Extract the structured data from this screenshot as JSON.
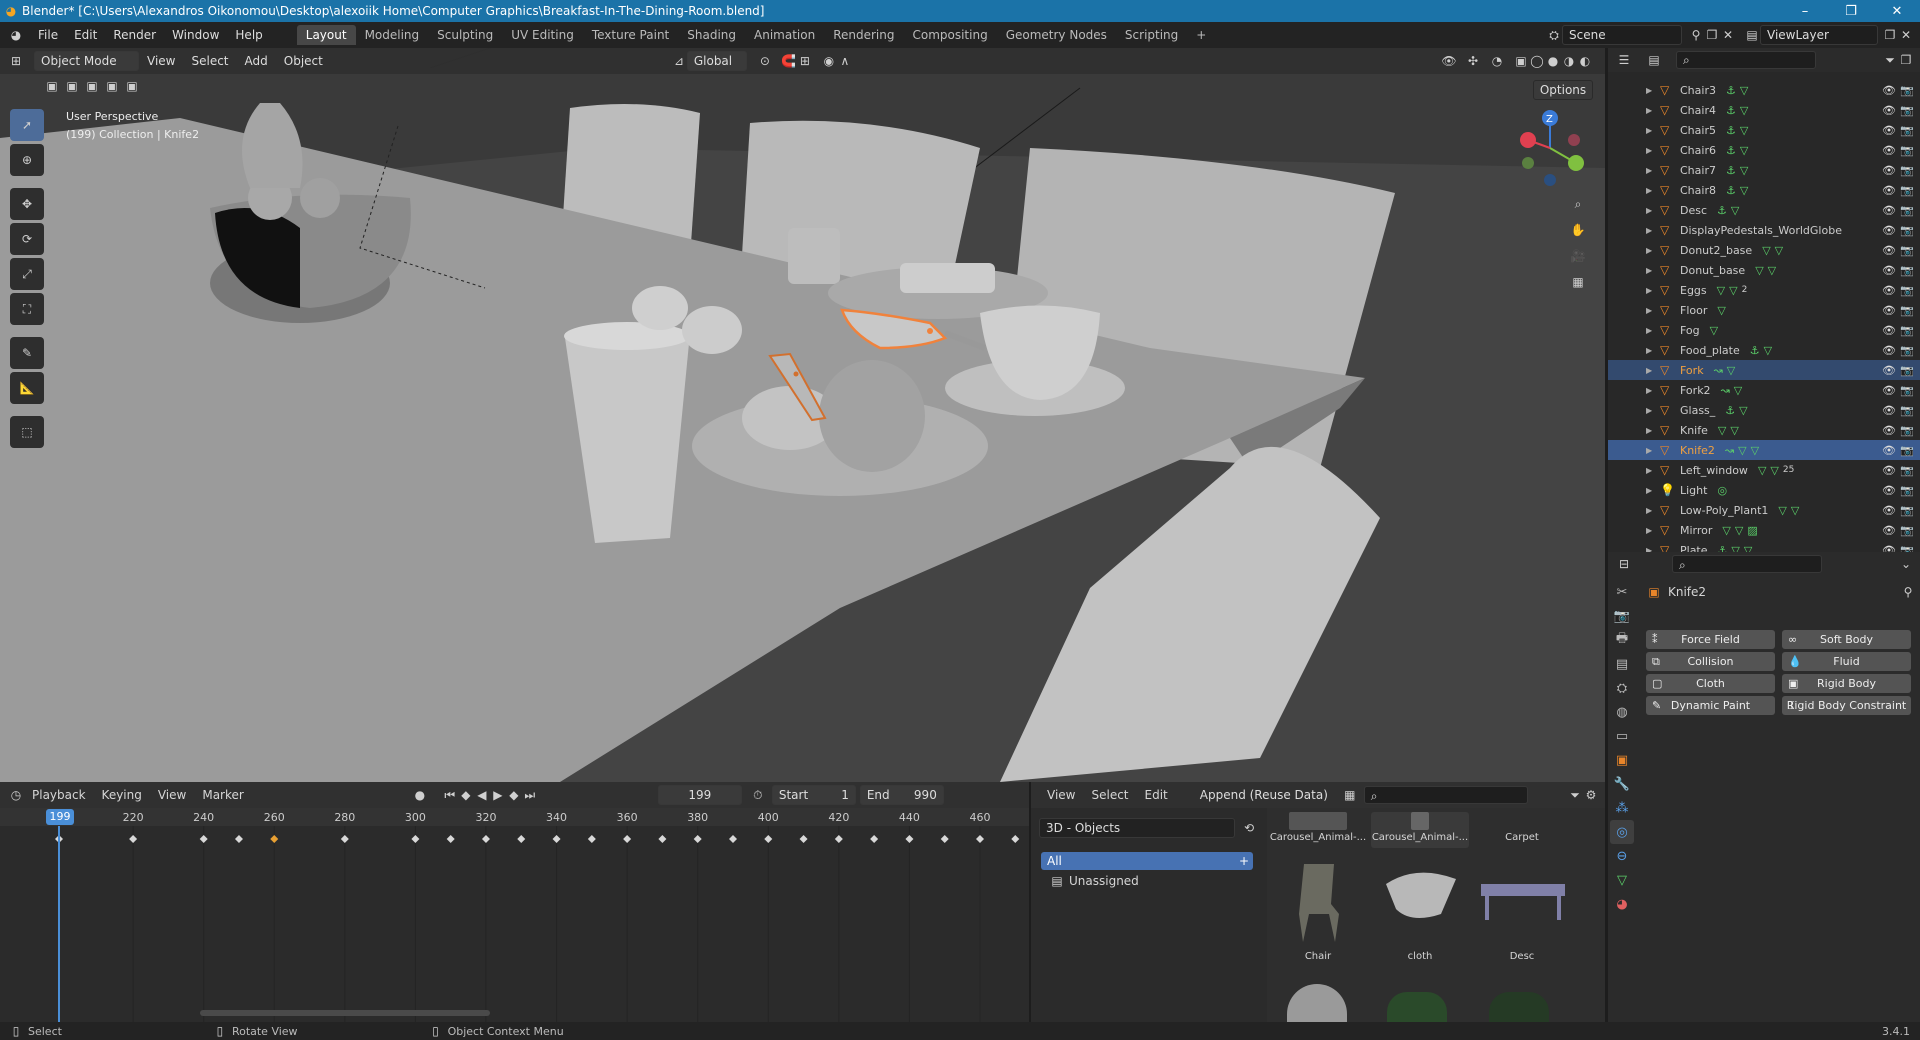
{
  "title_bar": {
    "text": "Blender* [C:\\Users\\Alexandros Oikonomou\\Desktop\\alexoiik Home\\Computer Graphics\\Breakfast-In-The-Dining-Room.blend]",
    "minimize": "–",
    "maximize": "❐",
    "close": "✕"
  },
  "menus": [
    "File",
    "Edit",
    "Render",
    "Window",
    "Help"
  ],
  "workspaces": [
    {
      "label": "Layout",
      "active": true
    },
    {
      "label": "Modeling"
    },
    {
      "label": "Sculpting"
    },
    {
      "label": "UV Editing"
    },
    {
      "label": "Texture Paint"
    },
    {
      "label": "Shading"
    },
    {
      "label": "Animation"
    },
    {
      "label": "Rendering"
    },
    {
      "label": "Compositing"
    },
    {
      "label": "Geometry Nodes"
    },
    {
      "label": "Scripting"
    }
  ],
  "add_workspace": "+",
  "scene": {
    "name": "Scene",
    "view_layer": "ViewLayer"
  },
  "viewport": {
    "mode": "Object Mode",
    "menus": [
      "View",
      "Select",
      "Add",
      "Object"
    ],
    "transform": "Global",
    "options": "Options",
    "info_line1": "User Perspective",
    "info_line2": "(199) Collection | Knife2",
    "gizmo": {
      "z": "Z",
      "x": "X",
      "y": "Y"
    }
  },
  "outliner": {
    "items": [
      {
        "name": "Chair3",
        "mods": "⚓▽"
      },
      {
        "name": "Chair4",
        "mods": "⚓▽"
      },
      {
        "name": "Chair5",
        "mods": "⚓▽"
      },
      {
        "name": "Chair6",
        "mods": "⚓▽"
      },
      {
        "name": "Chair7",
        "mods": "⚓▽"
      },
      {
        "name": "Chair8",
        "mods": "⚓▽"
      },
      {
        "name": "Desc",
        "mods": "⚓▽"
      },
      {
        "name": "DisplayPedestals_WorldGlobe",
        "mods": ""
      },
      {
        "name": "Donut2_base",
        "mods": "▽▽"
      },
      {
        "name": "Donut_base",
        "mods": "▽▽"
      },
      {
        "name": "Eggs",
        "mods": "▽▽",
        "badge": "2"
      },
      {
        "name": "Floor",
        "mods": "▽"
      },
      {
        "name": "Fog",
        "mods": "▽"
      },
      {
        "name": "Food_plate",
        "mods": "⚓▽"
      },
      {
        "name": "Fork",
        "mods": "↝▽",
        "state": "sel"
      },
      {
        "name": "Fork2",
        "mods": "↝▽"
      },
      {
        "name": "Glass_",
        "mods": "⚓▽"
      },
      {
        "name": "Knife",
        "mods": "▽▽"
      },
      {
        "name": "Knife2",
        "mods": "↝▽▽",
        "state": "active"
      },
      {
        "name": "Left_window",
        "mods": "▽▽",
        "badge": "25"
      },
      {
        "name": "Light",
        "mods": "◎",
        "type": "light"
      },
      {
        "name": "Low-Poly_Plant1",
        "mods": "▽▽"
      },
      {
        "name": "Mirror",
        "mods": "▽▽▨"
      },
      {
        "name": "Plate",
        "mods": "⚓▽▽"
      }
    ]
  },
  "properties": {
    "object": "Knife2",
    "physics": [
      {
        "label": "Force Field",
        "icon": "⁑"
      },
      {
        "label": "Soft Body",
        "icon": "∞"
      },
      {
        "label": "Collision",
        "icon": "⧉"
      },
      {
        "label": "Fluid",
        "icon": "💧"
      },
      {
        "label": "Cloth",
        "icon": "▢"
      },
      {
        "label": "Rigid Body",
        "icon": "▣"
      },
      {
        "label": "Dynamic Paint",
        "icon": "✎"
      },
      {
        "label": "Rigid Body Constraint",
        "icon": "⌶"
      }
    ]
  },
  "timeline": {
    "menus": [
      "Playback",
      "Keying",
      "View",
      "Marker"
    ],
    "current_frame": "199",
    "start_label": "Start",
    "start": "1",
    "end_label": "End",
    "end": "990",
    "ruler": [
      "199",
      "220",
      "240",
      "260",
      "280",
      "300",
      "320",
      "340",
      "360",
      "380",
      "400",
      "420",
      "440",
      "460"
    ]
  },
  "assets": {
    "menus": [
      "View",
      "Select",
      "Edit"
    ],
    "import": "Append (Reuse Data)",
    "library": "3D - Objects",
    "catalog_all": "All",
    "catalog_unassigned": "Unassigned",
    "items": [
      {
        "label": "Carousel_Animal-..."
      },
      {
        "label": "Carousel_Animal-..."
      },
      {
        "label": "Carpet"
      },
      {
        "label": "Chair"
      },
      {
        "label": "cloth"
      },
      {
        "label": "Desc"
      }
    ]
  },
  "status": {
    "select": "Select",
    "rotate": "Rotate View",
    "context": "Object Context Menu",
    "version": "3.4.1"
  },
  "colors": {
    "accent": "#4772b3",
    "selected_orange": "#f0823c",
    "keyframe": "#d8d8d8",
    "keyframe_active": "#e8a033",
    "playhead": "#4a8fd8"
  }
}
